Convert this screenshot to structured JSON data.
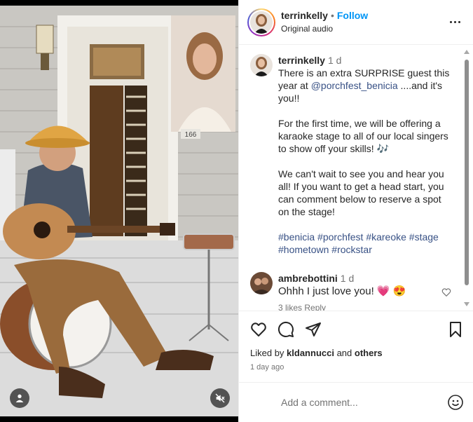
{
  "post": {
    "username": "terrinkelly",
    "separator": "•",
    "follow_label": "Follow",
    "audio": "Original audio"
  },
  "caption": {
    "username": "terrinkelly",
    "time": "1 d",
    "line1_pre": "There is an extra SURPRISE guest this year at ",
    "mention": "@porchfest_benicia",
    "line1_post": " ....and it's you!!",
    "para2": "For the first time, we will be offering a karaoke stage to all of our local singers to show off your skills! 🎶",
    "para3": "We can't wait to see you and hear you all! If you want to get a head start, you can comment below to reserve a spot on the stage!",
    "hashtags": [
      "#benicia",
      "#porchfest",
      "#kareoke",
      "#stage",
      "#hometown",
      "#rockstar"
    ]
  },
  "comment": {
    "username": "ambrebottini",
    "time": "1 d",
    "text": "Ohhh I just love you! 💗 😍",
    "replies_cut": "3 likes  Reply"
  },
  "likes": {
    "prefix": "Liked by ",
    "user": "kldannucci",
    "and": " and ",
    "others": "others"
  },
  "posted_ago": "1 day ago",
  "add_comment": {
    "placeholder": "Add a comment..."
  },
  "video_overlay": {
    "house_number": "166"
  },
  "colors": {
    "follow": "#0095f6",
    "link": "#385185",
    "text": "#262626",
    "muted": "#737373"
  }
}
